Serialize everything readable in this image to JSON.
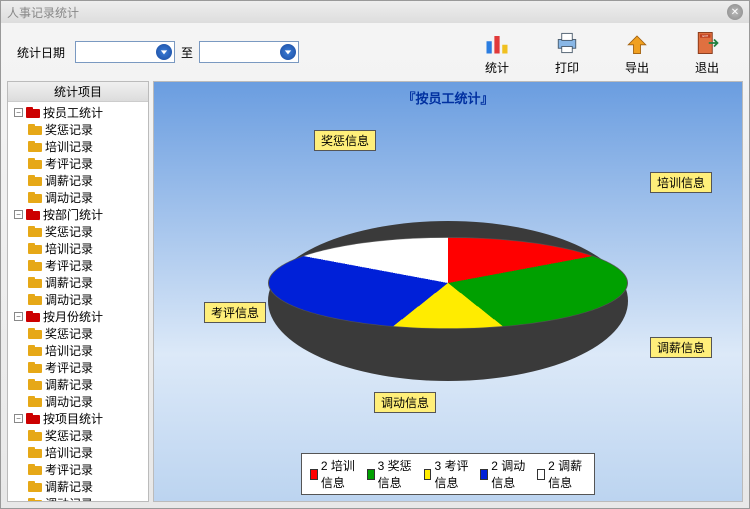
{
  "window": {
    "title": "人事记录统计"
  },
  "toolbar": {
    "date_label": "统计日期",
    "to_label": "至",
    "buttons": {
      "stats": "统计",
      "print": "打印",
      "export": "导出",
      "exit": "退出"
    }
  },
  "sidebar": {
    "header": "统计项目",
    "groups": [
      {
        "label": "按员工统计",
        "children": [
          "奖惩记录",
          "培训记录",
          "考评记录",
          "调薪记录",
          "调动记录"
        ]
      },
      {
        "label": "按部门统计",
        "children": [
          "奖惩记录",
          "培训记录",
          "考评记录",
          "调薪记录",
          "调动记录"
        ]
      },
      {
        "label": "按月份统计",
        "children": [
          "奖惩记录",
          "培训记录",
          "考评记录",
          "调薪记录",
          "调动记录"
        ]
      },
      {
        "label": "按项目统计",
        "children": [
          "奖惩记录",
          "培训记录",
          "考评记录",
          "调薪记录",
          "调动记录"
        ]
      }
    ]
  },
  "chart": {
    "title": "『按员工统计』",
    "labels": {
      "training": "培训信息",
      "reward": "奖惩信息",
      "review": "考评信息",
      "transfer": "调动信息",
      "salary": "调薪信息"
    }
  },
  "chart_data": {
    "type": "pie",
    "title": "按员工统计",
    "series": [
      {
        "name": "培训信息",
        "value": 2,
        "color": "#ff0000"
      },
      {
        "name": "奖惩信息",
        "value": 3,
        "color": "#00a000"
      },
      {
        "name": "考评信息",
        "value": 3,
        "color": "#ffec00"
      },
      {
        "name": "调动信息",
        "value": 2,
        "color": "#0020d8"
      },
      {
        "name": "调薪信息",
        "value": 2,
        "color": "#ffffff"
      }
    ]
  },
  "legend_prefix": {
    "a": "2",
    "b": "3",
    "c": "3",
    "d": "2",
    "e": "2"
  }
}
